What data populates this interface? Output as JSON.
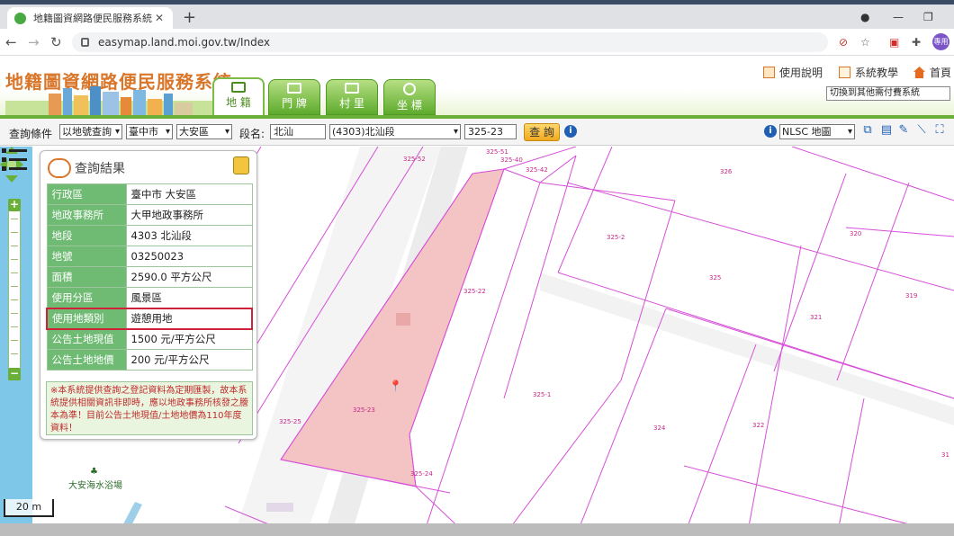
{
  "browser": {
    "tab_title": "地籍圖資網路便民服務系統",
    "tab_close": "✕",
    "new_tab": "+",
    "url": "easymap.land.moi.gov.tw/Index",
    "profile": "專用"
  },
  "header": {
    "logo": "地籍圖資網路便民服務系統",
    "tabs": [
      {
        "label": "地 籍",
        "active": true
      },
      {
        "label": "門 牌",
        "active": false
      },
      {
        "label": "村 里",
        "active": false
      },
      {
        "label": "坐 標",
        "active": false
      }
    ],
    "links": {
      "help": "使用說明",
      "tutorial": "系統教學",
      "home": "首頁"
    },
    "switch_system": "切換到其他需付費系統"
  },
  "query": {
    "label": "查詢條件",
    "mode": "以地號查詢",
    "city": "臺中市",
    "district": "大安區",
    "section_label": "段名:",
    "section_input": "北汕",
    "section_select": "(4303)北汕段",
    "parcel_input": "325-23",
    "submit": "查 詢",
    "basemap": "NLSC 地圖"
  },
  "result_panel": {
    "title": "查詢結果",
    "rows": [
      {
        "key": "行政區",
        "value": "臺中市 大安區"
      },
      {
        "key": "地政事務所",
        "value": "大甲地政事務所"
      },
      {
        "key": "地段",
        "value": "4303 北汕段"
      },
      {
        "key": "地號",
        "value": "03250023"
      },
      {
        "key": "面積",
        "value": "2590.0 平方公尺"
      },
      {
        "key": "使用分區",
        "value": "風景區"
      },
      {
        "key": "使用地類別",
        "value": "遊憩用地"
      },
      {
        "key": "公告土地現值",
        "value": "1500 元/平方公尺"
      },
      {
        "key": "公告土地地價",
        "value": "200 元/平方公尺"
      }
    ],
    "note": "※本系統提供查詢之登記資料為定期匯製，故本系統提供相關資訊非即時，應以地政事務所核發之謄本為準！目前公告土地現值/土地地價為110年度資料！"
  },
  "map": {
    "parcel_labels": [
      "325-52",
      "325-51",
      "325-40",
      "325-42",
      "326",
      "325-2",
      "320",
      "325",
      "319",
      "325-22",
      "321",
      "325-1",
      "325-23",
      "325-25",
      "324",
      "322",
      "325-24",
      "31"
    ],
    "poi": "大安海水浴場",
    "scale": "20 m"
  },
  "colors": {
    "parcel_line": "#d64fd8",
    "selected_fill": "#f4c3c3",
    "accent_green": "#6aaf37",
    "highlight": "#d0213a"
  }
}
